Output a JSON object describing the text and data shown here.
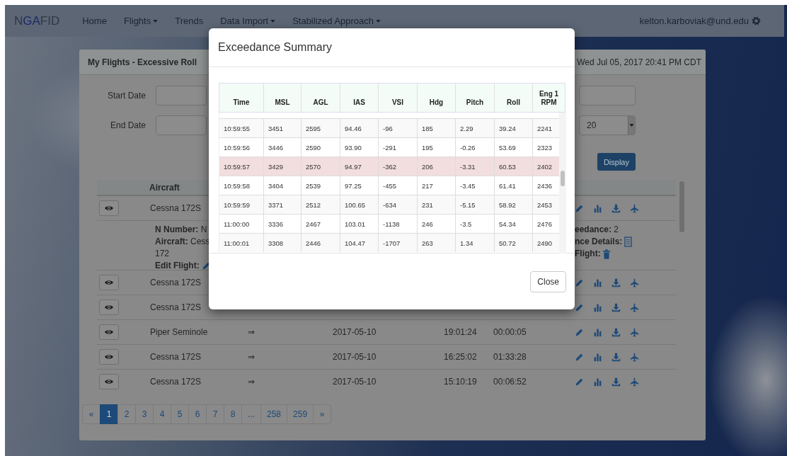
{
  "navbar": {
    "brand": "N**GA**FID",
    "items": [
      {
        "label": "Home",
        "dropdown": false
      },
      {
        "label": "Flights",
        "dropdown": true
      },
      {
        "label": "Trends",
        "dropdown": false
      },
      {
        "label": "Data Import",
        "dropdown": true
      },
      {
        "label": "Stabilized Approach",
        "dropdown": true
      }
    ],
    "user": "kelton.karboviak@und.edu"
  },
  "panel": {
    "title": "My Flights - Excessive Roll",
    "timestamp": "Wed Jul 05, 2017 20:41 PM CDT",
    "filters": [
      {
        "label": "Start Date"
      },
      {
        "label": "End Date"
      }
    ],
    "page_size": "20",
    "display_button": "Display",
    "aircraft_heading": "Aircraft",
    "rows": [
      {
        "aircraft": "Cessna 172S",
        "expanded": true,
        "details": {
          "left": [
            {
              "text": "**N Number:** N"
            },
            {
              "text": "**Aircraft:** Cess"
            },
            {
              "text": "172"
            },
            {
              "text": "**Edit Flight:**"
            }
          ],
          "right": [
            {
              "text": "**eedance:** 2"
            },
            {
              "text": "**nce Details:**"
            },
            {
              "text": "**Flight:**"
            }
          ]
        }
      },
      {
        "aircraft": "Cessna 172S",
        "expanded": false
      },
      {
        "aircraft": "Cessna 172S",
        "expanded": false
      },
      {
        "aircraft": "Piper Seminole",
        "expanded": false,
        "arrow": "⇒",
        "date": "2017-05-10",
        "start": "19:01:24",
        "duration": "00:00:05"
      },
      {
        "aircraft": "Cessna 172S",
        "expanded": false,
        "arrow": "⇒",
        "date": "2017-05-10",
        "start": "16:25:02",
        "duration": "01:33:28"
      },
      {
        "aircraft": "Cessna 172S",
        "expanded": false,
        "arrow": "⇒",
        "date": "2017-05-10",
        "start": "15:10:19",
        "duration": "00:06:52"
      }
    ],
    "pagination": [
      {
        "label": "«",
        "selected": false
      },
      {
        "label": "1",
        "selected": true
      },
      {
        "label": "2",
        "selected": false
      },
      {
        "label": "3",
        "selected": false
      },
      {
        "label": "4",
        "selected": false
      },
      {
        "label": "5",
        "selected": false
      },
      {
        "label": "6",
        "selected": false
      },
      {
        "label": "7",
        "selected": false
      },
      {
        "label": "8",
        "selected": false
      },
      {
        "label": "...",
        "selected": false
      },
      {
        "label": "258",
        "selected": false
      },
      {
        "label": "259",
        "selected": false
      },
      {
        "label": "»",
        "selected": false
      }
    ]
  },
  "modal": {
    "title": "Exceedance Summary",
    "columns": [
      "Time",
      "MSL",
      "AGL",
      "IAS",
      "VSI",
      "Hdg",
      "Pitch",
      "Roll",
      "Eng 1 RPM"
    ],
    "rows": [
      {
        "cells": [
          "10:59:55",
          "3451",
          "2595",
          "94.46",
          "-96",
          "185",
          "2.29",
          "39.24",
          "2241"
        ],
        "selected": false
      },
      {
        "cells": [
          "10:59:56",
          "3446",
          "2590",
          "93.90",
          "-291",
          "195",
          "-0.26",
          "53.69",
          "2323"
        ],
        "selected": false
      },
      {
        "cells": [
          "10:59:57",
          "3429",
          "2570",
          "94.97",
          "-362",
          "206",
          "-3.31",
          "60.53",
          "2402"
        ],
        "selected": true
      },
      {
        "cells": [
          "10:59:58",
          "3404",
          "2539",
          "97.25",
          "-455",
          "217",
          "-3.45",
          "61.41",
          "2436"
        ],
        "selected": false
      },
      {
        "cells": [
          "10:59:59",
          "3371",
          "2512",
          "100.65",
          "-634",
          "231",
          "-5.15",
          "58.92",
          "2453"
        ],
        "selected": false
      },
      {
        "cells": [
          "11:00:00",
          "3336",
          "2467",
          "103.01",
          "-1138",
          "246",
          "-3.5",
          "54.34",
          "2476"
        ],
        "selected": false
      },
      {
        "cells": [
          "11:00:01",
          "3308",
          "2446",
          "104.47",
          "-1707",
          "263",
          "1.34",
          "50.72",
          "2490"
        ],
        "selected": false
      }
    ],
    "close_button": "Close"
  }
}
